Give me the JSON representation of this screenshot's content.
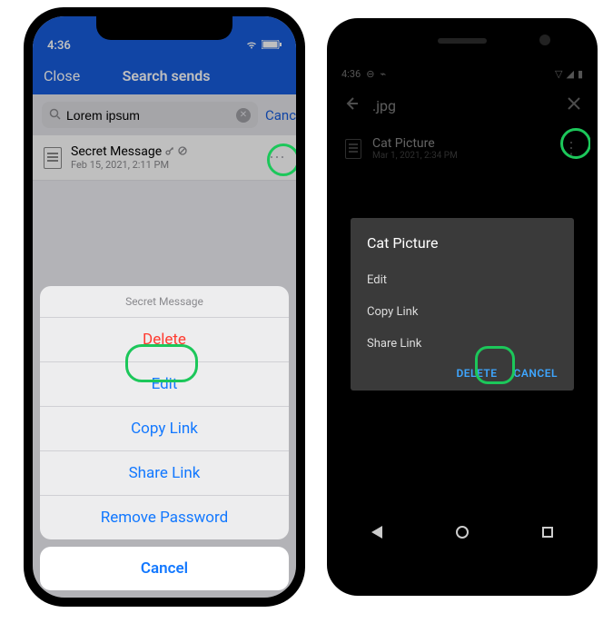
{
  "ios": {
    "status_time": "4:36",
    "nav_close": "Close",
    "nav_title": "Search sends",
    "search_value": "Lorem ipsum",
    "search_cancel": "Cancel",
    "item": {
      "title": "Secret Message",
      "subtitle": "Feb 15, 2021, 2:11 PM"
    },
    "sheet": {
      "header": "Secret Message",
      "delete": "Delete",
      "edit": "Edit",
      "copy_link": "Copy Link",
      "share_link": "Share Link",
      "remove_password": "Remove Password",
      "cancel": "Cancel"
    }
  },
  "android": {
    "status_time": "4:36",
    "appbar_title": ".jpg",
    "item": {
      "title": "Cat Picture",
      "subtitle": "Mar 1, 2021, 2:34 PM"
    },
    "dialog": {
      "title": "Cat Picture",
      "edit": "Edit",
      "copy_link": "Copy Link",
      "share_link": "Share Link",
      "delete": "DELETE",
      "cancel": "CANCEL"
    }
  }
}
